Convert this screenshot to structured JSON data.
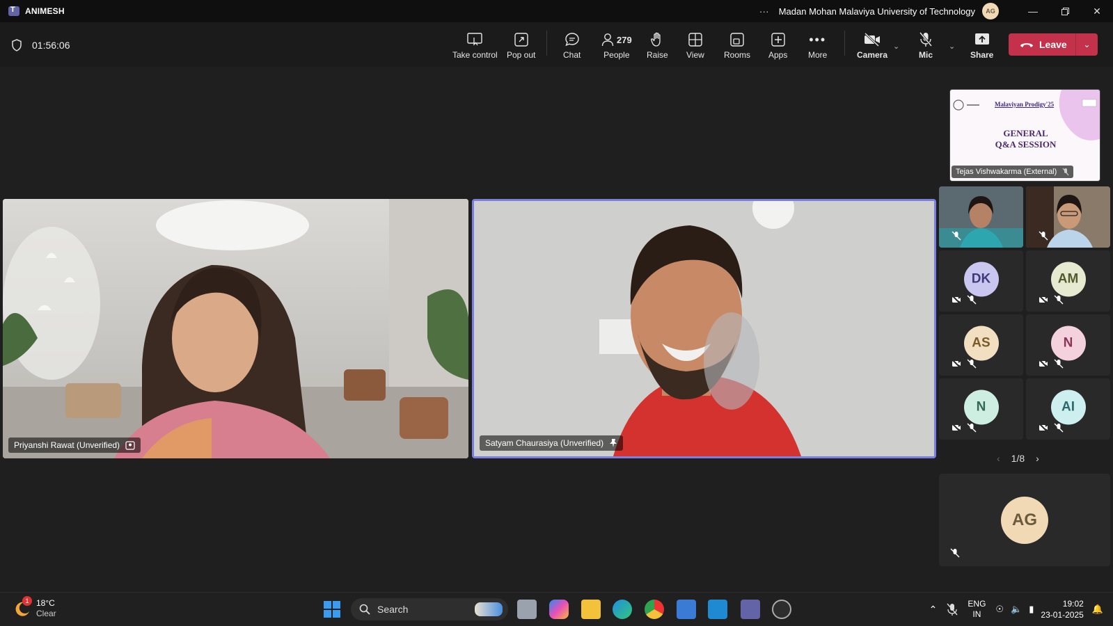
{
  "titlebar": {
    "app_name": "ANIMESH",
    "more": "···",
    "organization": "Madan Mohan Malaviya University of Technology",
    "avatar_initials": "AG"
  },
  "meeting": {
    "timer": "01:56:06",
    "controls": {
      "take_control": "Take control",
      "pop_out": "Pop out",
      "chat": "Chat",
      "people_count": "279",
      "people": "People",
      "raise": "Raise",
      "view": "View",
      "rooms": "Rooms",
      "apps": "Apps",
      "more": "More",
      "camera": "Camera",
      "mic": "Mic",
      "share": "Share",
      "leave": "Leave"
    }
  },
  "stage": {
    "main_videos": [
      {
        "name": "Priyanshi Rawat (Unverified)"
      },
      {
        "name": "Satyam Chaurasiya (Unverified)"
      }
    ],
    "presenter": {
      "name": "Tejas Vishwakarma (External)",
      "slide_header": "Malaviyan Prodigy'25",
      "slide_title_line1": "GENERAL",
      "slide_title_line2": "Q&A SESSION"
    },
    "tiles": [
      {
        "initials": "DK",
        "color": "#c9c6f0",
        "fg": "#3d3a7a"
      },
      {
        "initials": "AM",
        "color": "#e6ead0",
        "fg": "#545a2e"
      },
      {
        "initials": "AS",
        "color": "#f2dfc2",
        "fg": "#7a5a26"
      },
      {
        "initials": "N",
        "color": "#f3d2de",
        "fg": "#8a3556"
      },
      {
        "initials": "N",
        "color": "#cdeee0",
        "fg": "#2f6a52"
      },
      {
        "initials": "AI",
        "color": "#cdeff0",
        "fg": "#2e6a6c"
      }
    ],
    "pager": "1/8",
    "self_view": {
      "initials": "AG"
    }
  },
  "taskbar": {
    "weather_temp": "18°C",
    "weather_desc": "Clear",
    "weather_badge": "1",
    "search_placeholder": "Search",
    "lang_line1": "ENG",
    "lang_line2": "IN",
    "time": "19:02",
    "date": "23-01-2025"
  },
  "colors": {
    "accent": "#6264a7",
    "leave": "#c4314b",
    "active_border": "#7b7fe0"
  }
}
